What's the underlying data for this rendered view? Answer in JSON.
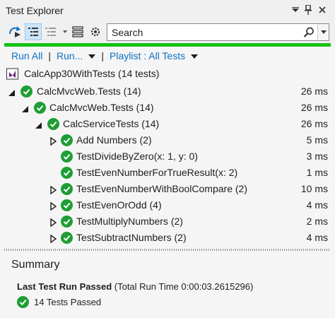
{
  "window": {
    "title": "Test Explorer"
  },
  "toolbar": {
    "search_placeholder": "Search"
  },
  "actions": {
    "run_all": "Run All",
    "run": "Run...",
    "playlist": "Playlist : All Tests"
  },
  "colors": {
    "accent": "#0e70c0",
    "pass": "#1e9e34",
    "progress": "#15c215"
  },
  "solution": {
    "label": "CalcApp30WithTests (14 tests)"
  },
  "tree": [
    {
      "label": "CalcMvcWeb.Tests (14)",
      "time": "26 ms"
    },
    {
      "label": "CalcMvcWeb.Tests (14)",
      "time": "26 ms"
    },
    {
      "label": "CalcServiceTests (14)",
      "time": "26 ms"
    },
    {
      "label": "Add Numbers (2)",
      "time": "5 ms"
    },
    {
      "label": "TestDivideByZero(x: 1, y: 0)",
      "time": "3 ms"
    },
    {
      "label": "TestEvenNumberForTrueResult(x: 2)",
      "time": "1 ms"
    },
    {
      "label": "TestEvenNumberWithBoolCompare (2)",
      "time": "10 ms"
    },
    {
      "label": "TestEvenOrOdd (4)",
      "time": "4 ms"
    },
    {
      "label": "TestMultiplyNumbers (2)",
      "time": "2 ms"
    },
    {
      "label": "TestSubtractNumbers (2)",
      "time": "4 ms"
    }
  ],
  "summary": {
    "heading": "Summary",
    "last_run": "Last Test Run Passed",
    "run_time": "(Total Run Time 0:00:03.2615296)",
    "passed": "14 Tests Passed"
  }
}
